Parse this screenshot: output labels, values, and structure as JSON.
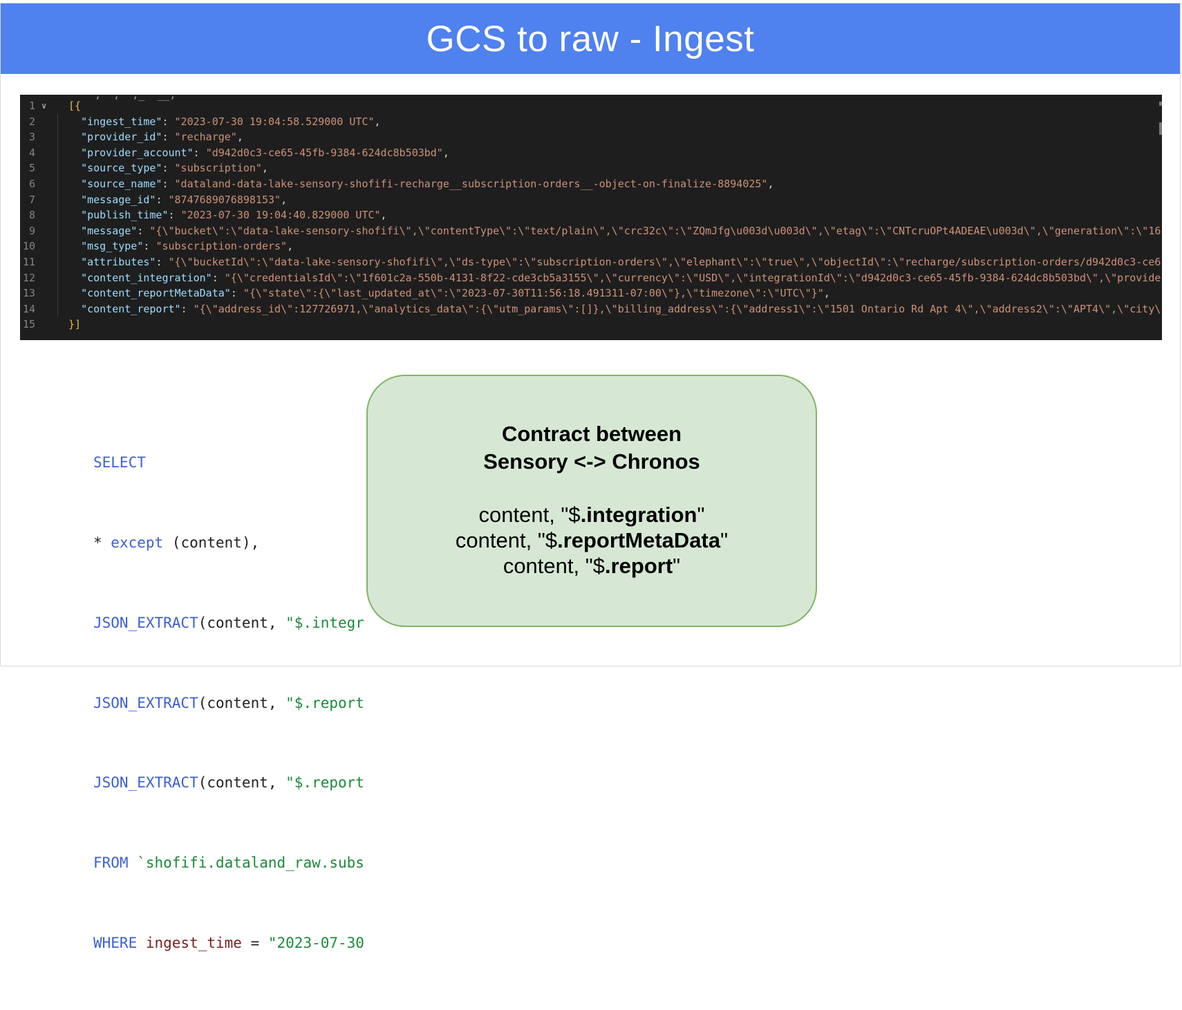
{
  "title": "GCS to raw - Ingest",
  "code": {
    "cut_top_text": "\"\",\"\",\"\",_\"\"__,\"\"",
    "lines": [
      {
        "n": "1",
        "open": "[{"
      },
      {
        "n": "2",
        "key": "\"ingest_time\"",
        "val": "\"2023-07-30 19:04:58.529000 UTC\"",
        "end": ","
      },
      {
        "n": "3",
        "key": "\"provider_id\"",
        "val": "\"recharge\"",
        "end": ","
      },
      {
        "n": "4",
        "key": "\"provider_account\"",
        "val": "\"d942d0c3-ce65-45fb-9384-624dc8b503bd\"",
        "end": ","
      },
      {
        "n": "5",
        "key": "\"source_type\"",
        "val": "\"subscription\"",
        "end": ","
      },
      {
        "n": "6",
        "key": "\"source_name\"",
        "val": "\"dataland-data-lake-sensory-shofifi-recharge__subscription-orders__-object-on-finalize-8894025\"",
        "end": ","
      },
      {
        "n": "7",
        "key": "\"message_id\"",
        "val": "\"8747689076898153\"",
        "end": ","
      },
      {
        "n": "8",
        "key": "\"publish_time\"",
        "val": "\"2023-07-30 19:04:40.829000 UTC\"",
        "end": ","
      },
      {
        "n": "9",
        "key": "\"message\"",
        "val": "\"{\\\"bucket\\\":\\\"data-lake-sensory-shofifi\\\",\\\"contentType\\\":\\\"text/plain\\\",\\\"crc32c\\\":\\\"ZQmJfg\\u003d\\u003d\\\",\\\"etag\\\":\\\"CNTcruOPt4ADEAE\\u003d\\\",\\\"generation\\\":\\\"16",
        "end": ""
      },
      {
        "n": "10",
        "key": "\"msg_type\"",
        "val": "\"subscription-orders\"",
        "end": ","
      },
      {
        "n": "11",
        "key": "\"attributes\"",
        "val": "\"{\\\"bucketId\\\":\\\"data-lake-sensory-shofifi\\\",\\\"ds-type\\\":\\\"subscription-orders\\\",\\\"elephant\\\":\\\"true\\\",\\\"objectId\\\":\\\"recharge/subscription-orders/d942d0c3-ce6",
        "end": ""
      },
      {
        "n": "12",
        "key": "\"content_integration\"",
        "val": "\"{\\\"credentialsId\\\":\\\"1f601c2a-550b-4131-8f22-cde3cb5a3155\\\",\\\"currency\\\":\\\"USD\\\",\\\"integrationId\\\":\\\"d942d0c3-ce65-45fb-9384-624dc8b503bd\\\",\\\"provide",
        "end": ""
      },
      {
        "n": "13",
        "key": "\"content_reportMetaData\"",
        "val": "\"{\\\"state\\\":{\\\"last_updated_at\\\":\\\"2023-07-30T11:56:18.491311-07:00\\\"},\\\"timezone\\\":\\\"UTC\\\"}\"",
        "end": ","
      },
      {
        "n": "14",
        "key": "\"content_report\"",
        "val": "\"{\\\"address_id\\\":127726971,\\\"analytics_data\\\":{\\\"utm_params\\\":[]},\\\"billing_address\\\":{\\\"address1\\\":\\\"1501 Ontario Rd Apt 4\\\",\\\"address2\\\":\\\"APT4\\\",\\\"city\\",
        "end": ""
      },
      {
        "n": "15",
        "close": "}]"
      }
    ]
  },
  "sql": {
    "select": "SELECT",
    "star": "* ",
    "except": "except",
    "except_args": " (content),",
    "json_extract": "JSON_EXTRACT",
    "args_prefix": "(content, ",
    "path1": "\"$.integr",
    "path2": "\"$.report",
    "path3": "\"$.report",
    "from": "FROM",
    "table": " `shofifi.dataland_raw.subs",
    "where": "WHERE",
    "ingest_time": " ingest_time",
    "eq": " = ",
    "date": "\"2023-07-30"
  },
  "contract": {
    "heading_line1": "Contract between",
    "heading_line2": "Sensory <-> Chronos",
    "prefix1": "content, \"$",
    "bold1": ".integration",
    "suffix1": "\"",
    "prefix2": "content, \"$",
    "bold2": ".reportMetaData",
    "suffix2": "\"",
    "prefix3": "content, \"$",
    "bold3": ".report",
    "suffix3": "\""
  }
}
